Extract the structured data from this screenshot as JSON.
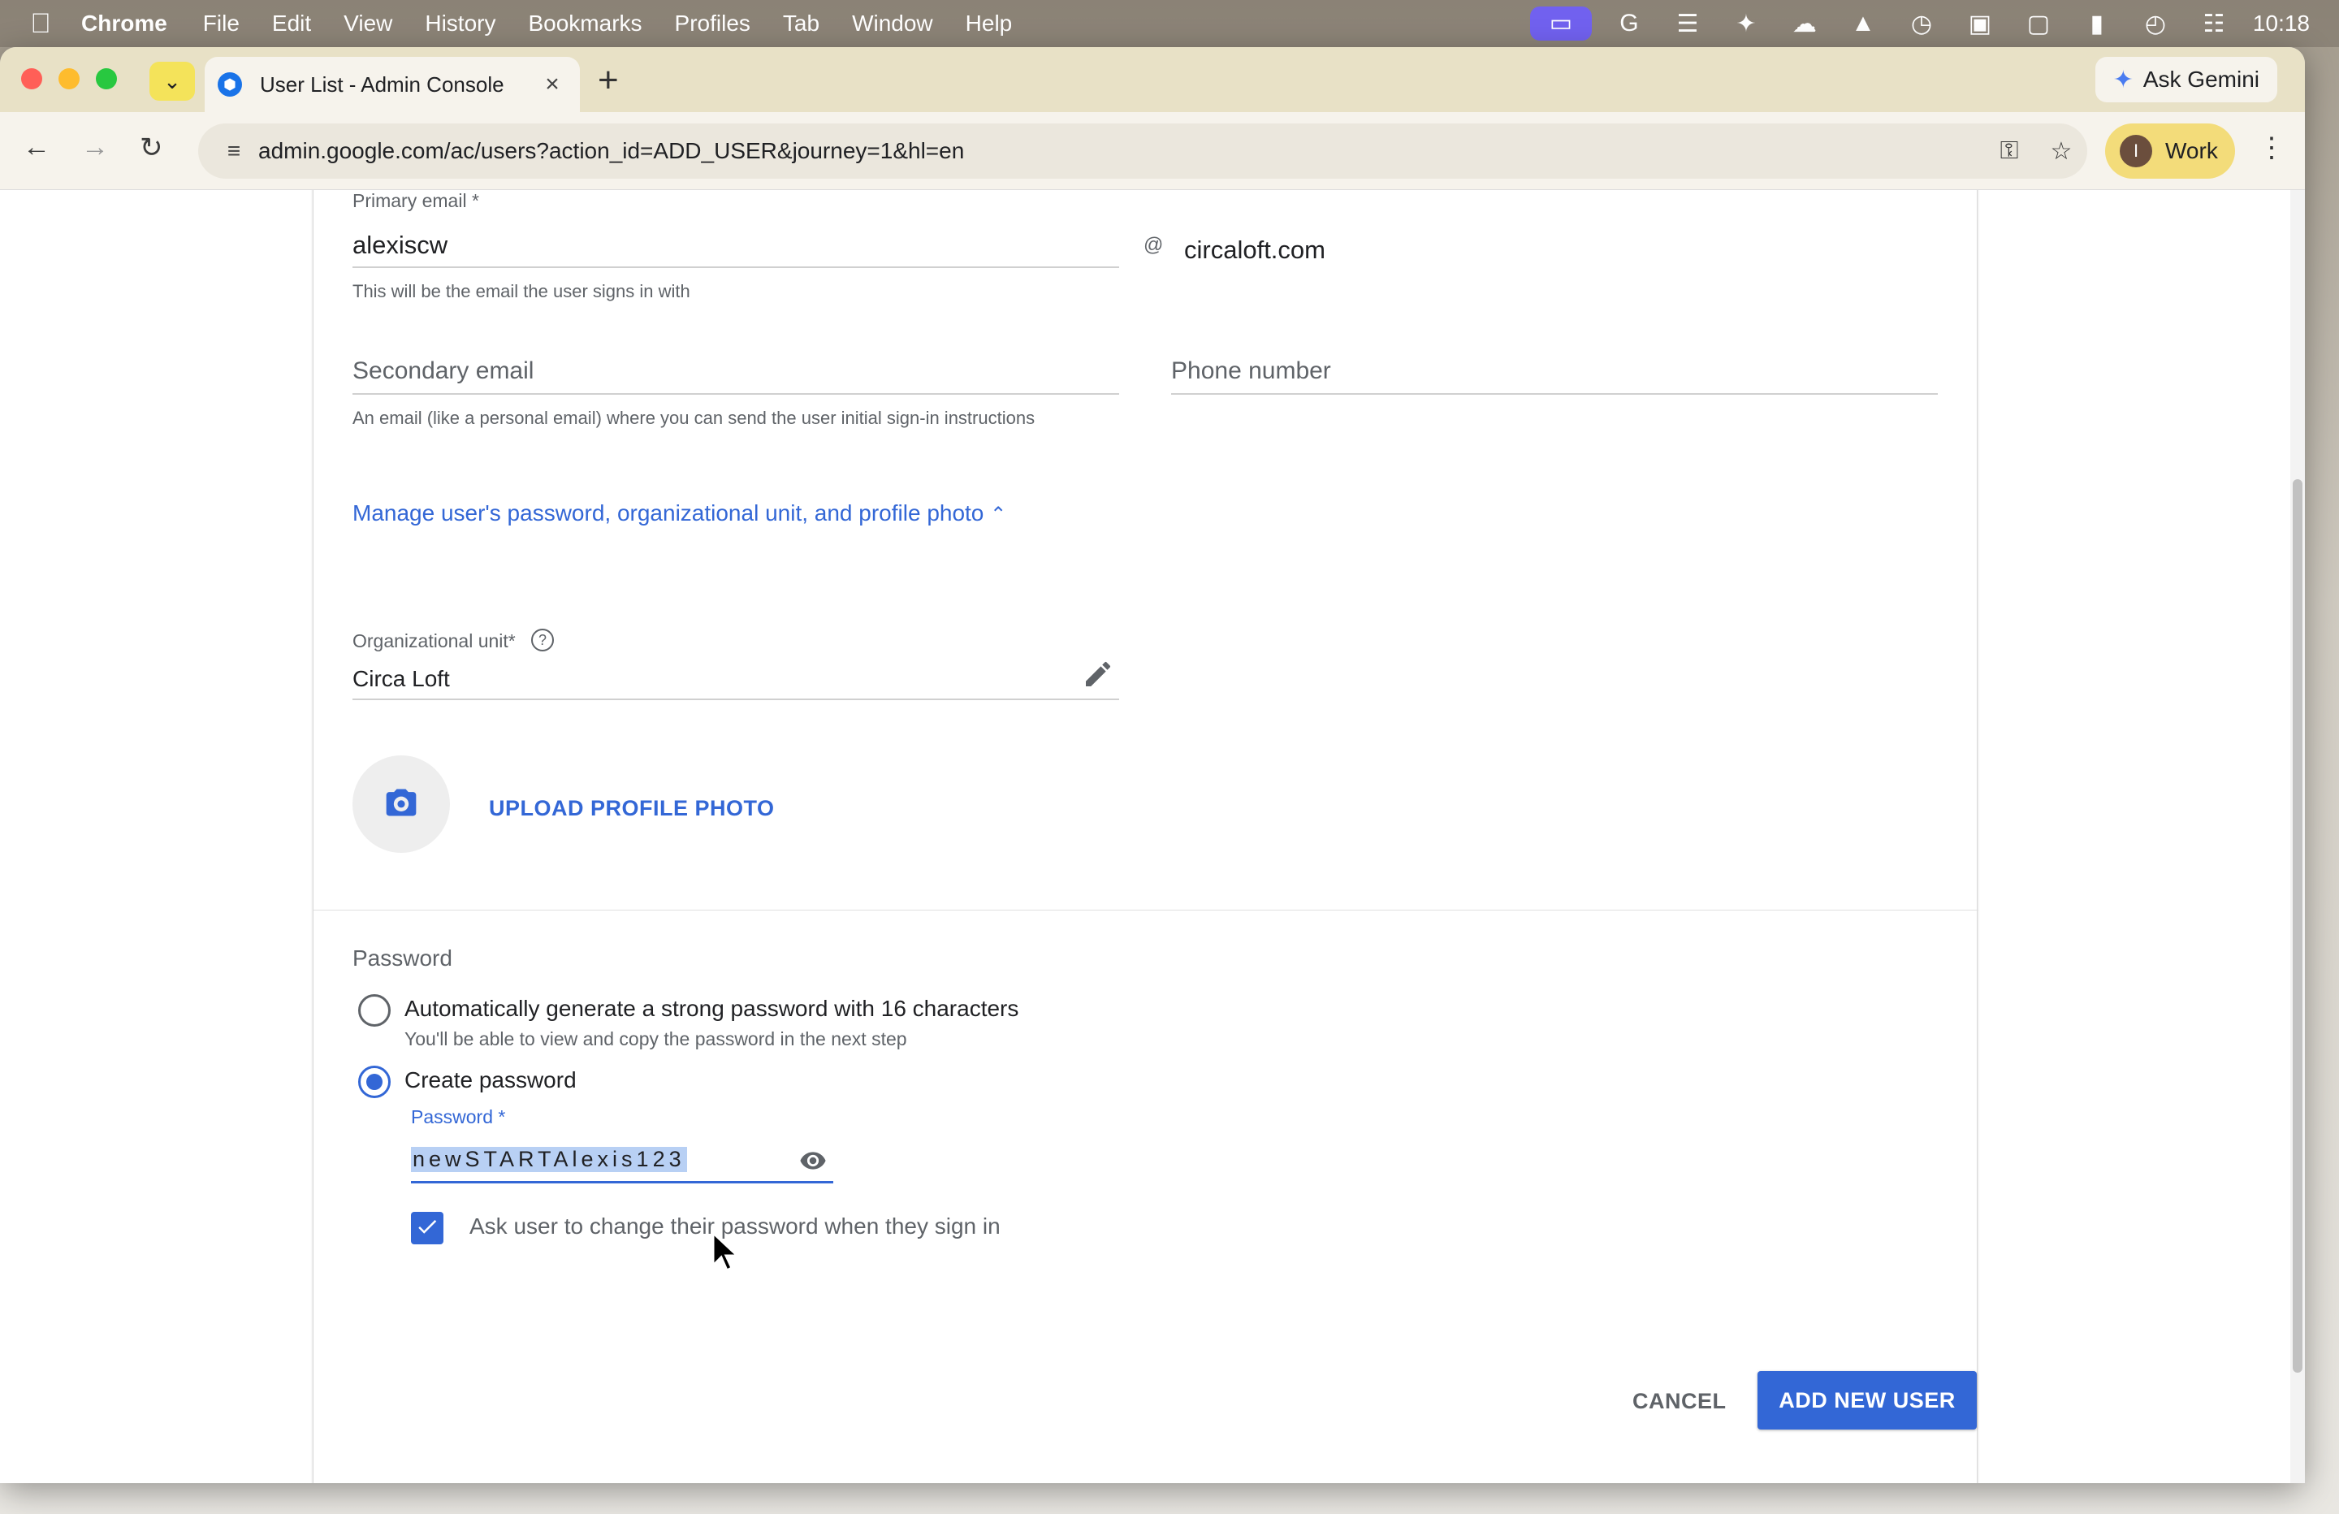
{
  "menubar": {
    "items": [
      "Chrome",
      "File",
      "Edit",
      "View",
      "History",
      "Bookmarks",
      "Profiles",
      "Tab",
      "Window",
      "Help"
    ],
    "clock": "10:18"
  },
  "browser": {
    "tab_title": "User List - Admin Console",
    "ask_gemini": "Ask Gemini",
    "url": "admin.google.com/ac/users?action_id=ADD_USER&journey=1&hl=en",
    "profile_initial": "I",
    "profile_name": "Work"
  },
  "form": {
    "primary_email_label": "Primary email *",
    "primary_email_value": "alexiscw",
    "at_sign": "@",
    "domain": "circaloft.com",
    "primary_email_helper": "This will be the email the user signs in with",
    "secondary_email_placeholder": "Secondary email",
    "secondary_email_helper": "An email (like a personal email) where you can send the user initial sign-in instructions",
    "phone_placeholder": "Phone number",
    "manage_link": "Manage user's password, organizational unit, and profile photo",
    "org_unit_label": "Organizational unit*",
    "org_unit_value": "Circa Loft",
    "upload_photo": "UPLOAD PROFILE PHOTO"
  },
  "password": {
    "section_title": "Password",
    "option_auto_label": "Automatically generate a strong password with 16 characters",
    "option_auto_sub": "You'll be able to view and copy the password in the next step",
    "option_create_label": "Create password",
    "selected_option": "create",
    "field_label": "Password *",
    "field_value": "newSTARTAlexis123",
    "ask_change_label": "Ask user to change their password when they sign in",
    "ask_change_checked": true
  },
  "actions": {
    "cancel": "CANCEL",
    "add_user": "ADD NEW USER"
  },
  "colors": {
    "accent": "#3367d6",
    "tabbar": "#e8e1c6",
    "profile_chip": "#f3dc7a"
  }
}
